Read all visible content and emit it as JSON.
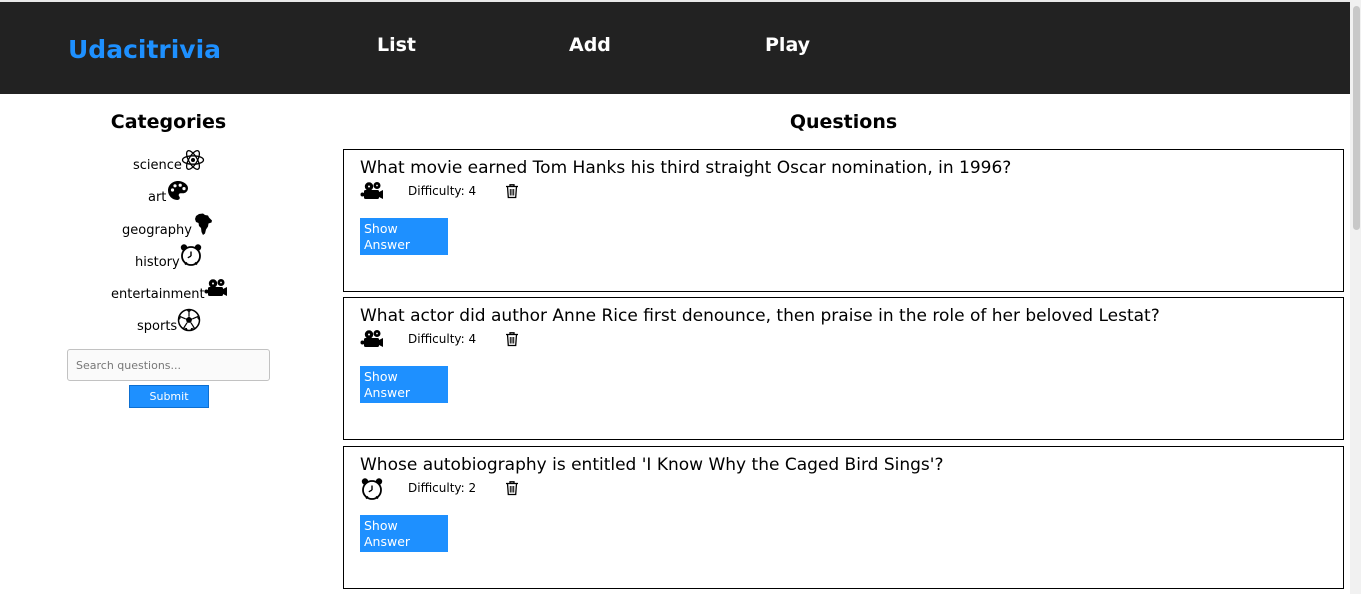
{
  "header": {
    "brand": "Udacitrivia",
    "nav": [
      "List",
      "Add",
      "Play"
    ]
  },
  "sidebar": {
    "title": "Categories",
    "categories": [
      {
        "label": "science",
        "icon": "atom-icon"
      },
      {
        "label": "art",
        "icon": "palette-icon"
      },
      {
        "label": "geography",
        "icon": "africa-map-icon"
      },
      {
        "label": "history",
        "icon": "alarm-clock-icon"
      },
      {
        "label": "entertainment",
        "icon": "film-projector-icon"
      },
      {
        "label": "sports",
        "icon": "soccer-ball-icon"
      }
    ],
    "search_placeholder": "Search questions...",
    "submit_label": "Submit"
  },
  "main": {
    "title": "Questions",
    "questions": [
      {
        "question": "What movie earned Tom Hanks his third straight Oscar nomination, in 1996?",
        "category_icon": "film-projector-icon",
        "difficulty": "Difficulty: 4",
        "show_answer_label": "Show Answer"
      },
      {
        "question": "What actor did author Anne Rice first denounce, then praise in the role of her beloved Lestat?",
        "category_icon": "film-projector-icon",
        "difficulty": "Difficulty: 4",
        "show_answer_label": "Show Answer"
      },
      {
        "question": "Whose autobiography is entitled 'I Know Why the Caged Bird Sings'?",
        "category_icon": "alarm-clock-icon",
        "difficulty": "Difficulty: 2",
        "show_answer_label": "Show Answer"
      }
    ]
  },
  "colors": {
    "header_bg": "#222222",
    "brand": "#1e90ff",
    "button": "#1e90ff"
  }
}
